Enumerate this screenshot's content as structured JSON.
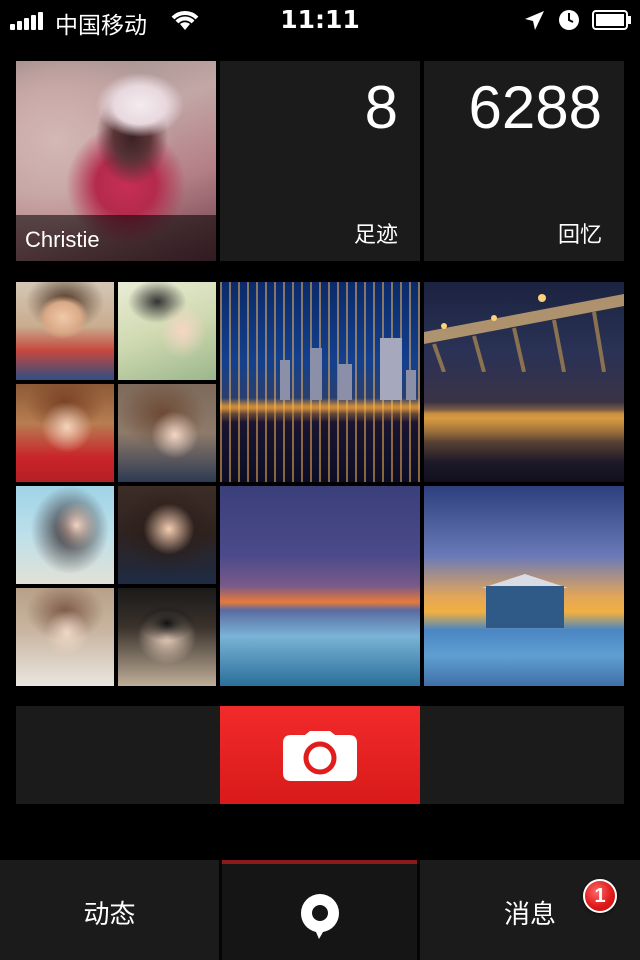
{
  "status_bar": {
    "carrier": "中国移动",
    "time": "11:11"
  },
  "profile": {
    "name": "Christie"
  },
  "stats": {
    "footprints": {
      "value": "8",
      "label": "足迹"
    },
    "memories": {
      "value": "6288",
      "label": "回忆"
    }
  },
  "tab_bar": {
    "feed_label": "动态",
    "messages_label": "消息",
    "messages_badge": "1"
  },
  "colors": {
    "accent": "#e8201f",
    "tile_background": "#1b1b1b",
    "badge": "#e01b1b"
  },
  "icons": {
    "signal": "signal-icon",
    "wifi": "wifi-icon",
    "location": "location-arrow-icon",
    "clock": "clock-icon",
    "battery": "battery-icon",
    "camera": "camera-icon",
    "map_pin": "map-pin-icon"
  }
}
